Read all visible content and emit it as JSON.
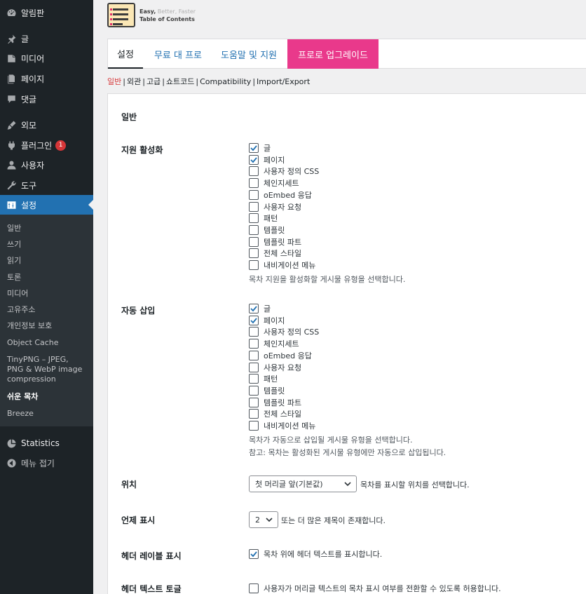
{
  "sidebar": {
    "items": [
      {
        "label": "알림판",
        "icon": "dashboard-icon"
      },
      {
        "label": "글",
        "icon": "pin-icon"
      },
      {
        "label": "미디어",
        "icon": "media-icon"
      },
      {
        "label": "페이지",
        "icon": "page-icon"
      },
      {
        "label": "댓글",
        "icon": "comment-icon"
      },
      {
        "label": "외모",
        "icon": "brush-icon"
      },
      {
        "label": "플러그인",
        "icon": "plugin-icon",
        "badge": "1"
      },
      {
        "label": "사용자",
        "icon": "user-icon"
      },
      {
        "label": "도구",
        "icon": "wrench-icon"
      },
      {
        "label": "설정",
        "icon": "settings-icon"
      }
    ],
    "submenu": [
      "일반",
      "쓰기",
      "읽기",
      "토론",
      "미디어",
      "고유주소",
      "개인정보 보호",
      "Object Cache",
      "TinyPNG – JPEG, PNG & WebP image compression",
      "쉬운 목차",
      "Breeze"
    ],
    "bottom": [
      {
        "label": "Statistics",
        "icon": "chart-pie-icon"
      },
      {
        "label": "메뉴 접기",
        "icon": "collapse-icon"
      }
    ]
  },
  "plugin": {
    "tagline_easy": "Easy,",
    "tagline_rest": " Better, Faster",
    "name": "Table of Contents"
  },
  "tabs": [
    "설정",
    "무료 대 프로",
    "도움말 및 지원",
    "프로로 업그레이드"
  ],
  "subnav": [
    "일반",
    "외관",
    "고급",
    "쇼트코드",
    "Compatibility",
    "Import/Export"
  ],
  "main": {
    "section_title": "일반",
    "support": {
      "label": "지원 활성화",
      "options": [
        {
          "label": "글",
          "checked": true
        },
        {
          "label": "페이지",
          "checked": true
        },
        {
          "label": "사용자 정의 CSS",
          "checked": false
        },
        {
          "label": "체인지세트",
          "checked": false
        },
        {
          "label": "oEmbed 응답",
          "checked": false
        },
        {
          "label": "사용자 요청",
          "checked": false
        },
        {
          "label": "패턴",
          "checked": false
        },
        {
          "label": "템플릿",
          "checked": false
        },
        {
          "label": "템플릿 파트",
          "checked": false
        },
        {
          "label": "전체 스타일",
          "checked": false
        },
        {
          "label": "내비게이션 메뉴",
          "checked": false
        }
      ],
      "description": "목차 지원을 활성화할 게시물 유형을 선택합니다."
    },
    "auto_insert": {
      "label": "자동 삽입",
      "options": [
        {
          "label": "글",
          "checked": true
        },
        {
          "label": "페이지",
          "checked": true
        },
        {
          "label": "사용자 정의 CSS",
          "checked": false
        },
        {
          "label": "체인지세트",
          "checked": false
        },
        {
          "label": "oEmbed 응답",
          "checked": false
        },
        {
          "label": "사용자 요청",
          "checked": false
        },
        {
          "label": "패턴",
          "checked": false
        },
        {
          "label": "템플릿",
          "checked": false
        },
        {
          "label": "템플릿 파트",
          "checked": false
        },
        {
          "label": "전체 스타일",
          "checked": false
        },
        {
          "label": "내비게이션 메뉴",
          "checked": false
        }
      ],
      "description": "목차가 자동으로 삽입될 게시물 유형을 선택합니다.",
      "note": "참고: 목차는 활성화된 게시물 유형에만 자동으로 삽입됩니다."
    },
    "position": {
      "label": "위치",
      "value": "첫 머리글 앞(기본값)",
      "description": "목차를 표시할 위치를 선택합니다."
    },
    "show_when": {
      "label": "언제 표시",
      "value": "2",
      "description": "또는 더 많은 제목이 존재합니다."
    },
    "header_label": {
      "label": "헤더 레이블 표시",
      "checked": true,
      "description": "목차 위에 헤더 텍스트를 표시합니다."
    },
    "header_toggle": {
      "label": "헤더 텍스트 토글",
      "checked": false,
      "description": "사용자가 머리글 텍스트의 목차 표시 여부를 전환할 수 있도록 허용합니다."
    }
  },
  "colors": {
    "sidebar_bg": "#1d2327",
    "submenu_bg": "#2c3338",
    "accent": "#2271b1",
    "pro_tab": "#e9398b",
    "badge": "#d63638"
  }
}
